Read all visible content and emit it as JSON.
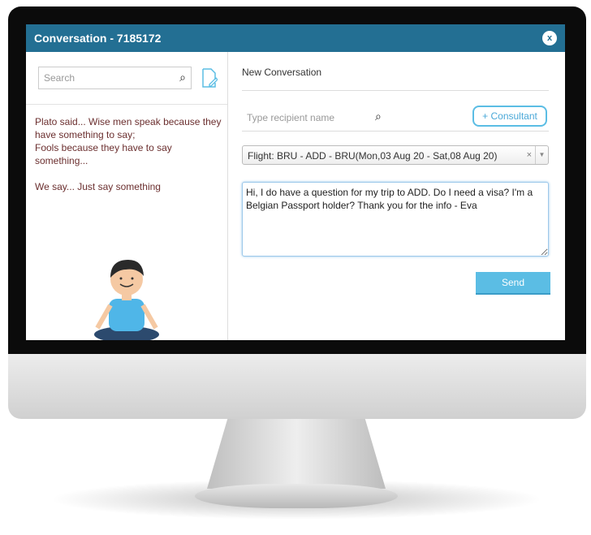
{
  "window": {
    "title": "Conversation - 7185172",
    "close_label": "x"
  },
  "sidebar": {
    "search_placeholder": "Search",
    "quote": [
      "Plato said... Wise men speak because they have something to say;\nFools because they have to say something...",
      "We say... Just say something"
    ]
  },
  "main": {
    "heading": "New Conversation",
    "recipient_placeholder": "Type recipient name",
    "consultant_button": "+ Consultant",
    "trip_select": "Flight: BRU - ADD - BRU(Mon,03 Aug 20 - Sat,08 Aug 20)",
    "clear_label": "×",
    "message": "Hi, I do have a question for my trip to ADD. Do I need a visa? I'm a Belgian Passport holder? Thank you for the info - Eva",
    "send_button": "Send"
  },
  "colors": {
    "header": "#236f93",
    "accent": "#5bbde4",
    "quote_text": "#6b2f2f"
  }
}
